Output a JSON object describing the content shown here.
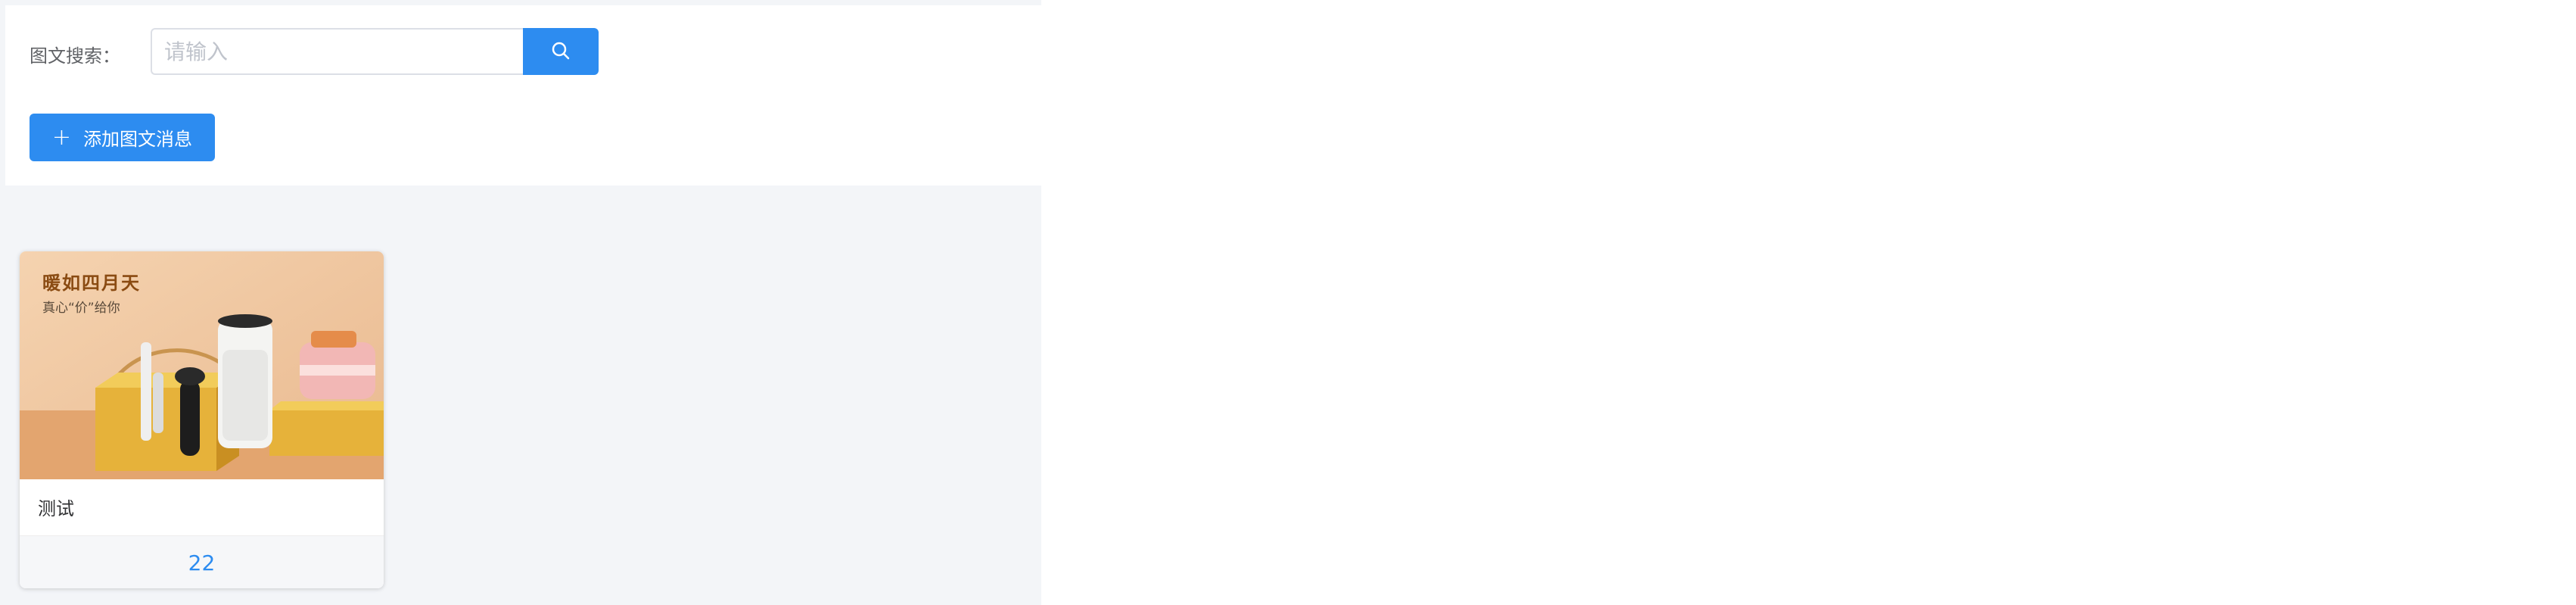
{
  "search": {
    "label": "图文搜索：",
    "placeholder": "请输入",
    "value": ""
  },
  "actions": {
    "add_label": "添加图文消息"
  },
  "icons": {
    "search": "search-icon",
    "add": "plus-icon"
  },
  "colors": {
    "primary": "#2d8cf0",
    "page_bg": "#f3f5f8"
  },
  "cards": [
    {
      "banner_title": "暖如四月天",
      "banner_subtitle": "真心“价”给你",
      "title": "测试",
      "count": "22"
    }
  ]
}
